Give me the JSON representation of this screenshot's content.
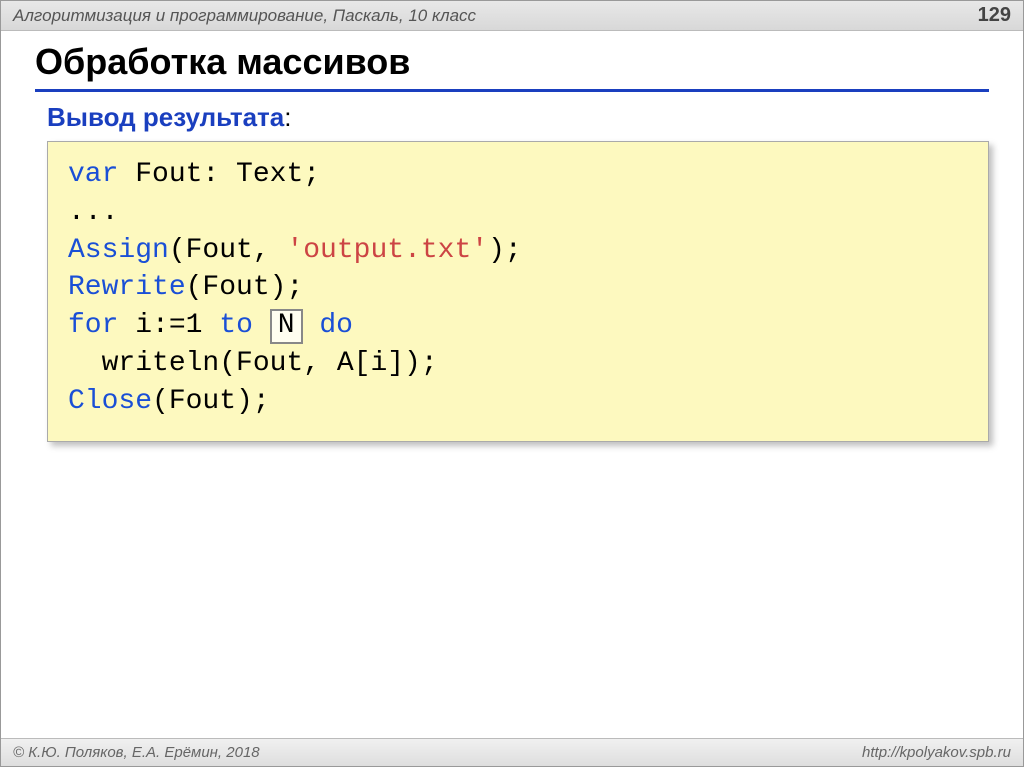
{
  "header": {
    "course": "Алгоритмизация и программирование, Паскаль, 10 класс",
    "page_number": "129"
  },
  "title": "Обработка массивов",
  "subtitle": "Вывод результата",
  "subtitle_colon": ":",
  "code": {
    "line1_a": "var",
    "line1_b": " Fout: Text;",
    "line2": "...",
    "line3_a": "Assign",
    "line3_b": "(Fout, ",
    "line3_c": "'output.txt'",
    "line3_d": ");",
    "line4_a": "Rewrite",
    "line4_b": "(Fout);",
    "line5_a": "for",
    "line5_b": " i:=",
    "line5_c": "1",
    "line5_d": " ",
    "line5_e": "to",
    "line5_f": " ",
    "line5_n": "N",
    "line5_g": " ",
    "line5_h": "do",
    "line6": "  writeln(Fout, A[i]);",
    "line7_a": "Close",
    "line7_b": "(Fout);"
  },
  "footer": {
    "copyright": "© К.Ю. Поляков, Е.А. Ерёмин, 2018",
    "url": "http://kpolyakov.spb.ru"
  }
}
